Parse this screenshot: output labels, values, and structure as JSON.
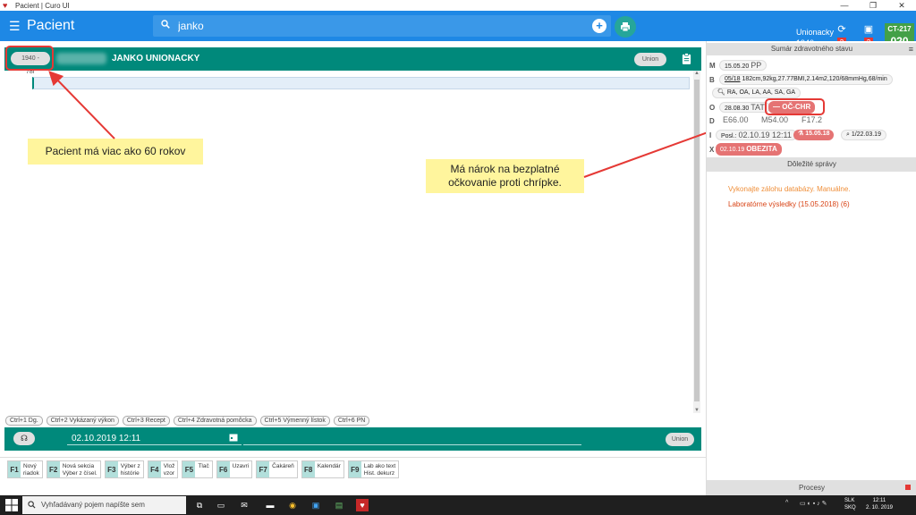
{
  "window": {
    "title": "Pacient | Curo UI"
  },
  "appbar": {
    "title": "Pacient",
    "search_value": "janko",
    "user_name": "Unionacky",
    "user_year": "1940",
    "sync_badge": "2",
    "alert_badge": "2",
    "ct_code": "CT-217",
    "ct_number": "020"
  },
  "patient": {
    "age_pill": "1940 - 78r",
    "name": "JANKO UNIONACKY",
    "insurer_pill": "Union"
  },
  "annotations": {
    "age_note": "Pacient má viac ako 60 rokov",
    "vaccination_note_line1": "Má nárok na bezplatné",
    "vaccination_note_line2": "očkovanie proti chrípke."
  },
  "shortcuts": [
    "Ctrl+1 Dg.",
    "Ctrl+2 Vykázaný výkon",
    "Ctrl+3 Recept",
    "Ctrl+4 Zdravotná pomôcka",
    "Ctrl+5 Výmenný lístok",
    "Ctrl+6 PN"
  ],
  "bottom_bar": {
    "datetime": "02.10.2019 12:11",
    "insurer_pill": "Union"
  },
  "function_keys": [
    {
      "key": "F1",
      "line1": "Nový",
      "line2": "riadok"
    },
    {
      "key": "F2",
      "line1": "Nová sekcia",
      "line2": "Výber z čísel."
    },
    {
      "key": "F3",
      "line1": "Výber z",
      "line2": "histórie"
    },
    {
      "key": "F4",
      "line1": "Vlož",
      "line2": "vzor"
    },
    {
      "key": "F5",
      "line1": "Tlač",
      "line2": ""
    },
    {
      "key": "F6",
      "line1": "Uzavri",
      "line2": ""
    },
    {
      "key": "F7",
      "line1": "Čakáreň",
      "line2": ""
    },
    {
      "key": "F8",
      "line1": "Kalendár",
      "line2": ""
    },
    {
      "key": "F9",
      "line1": "Lab ako text",
      "line2": "Hist. dekurz"
    }
  ],
  "summary": {
    "header": "Sumár zdravotného stavu",
    "m_letter": "M",
    "m_date": "15.05.20",
    "m_code": "PP",
    "b_letter": "B",
    "b_date": "05/18",
    "b_values": "182cm,92kg,27.77BMI,2.14m2,120/68mmHg,68/min",
    "b_tags": "RA, OA, LA, AA, SA, GA",
    "o_letter": "O",
    "o_date": "28.08.30",
    "o_code": "TAT",
    "o_occhr": "— OČ-CHR",
    "d_letter": "D",
    "d_code1": "E66.00",
    "d_code2": "M54.00",
    "d_code3": "F17.2",
    "i_letter": "I",
    "i_label": "Posl.:",
    "i_date": "02.10.19 12:11",
    "i_chip": "15.05.18",
    "i_attach": "1/22.03.19",
    "x_letter": "X",
    "x_date": "02.10.19",
    "x_label": "OBEZITA"
  },
  "messages": {
    "header": "Dôležité správy",
    "items": [
      "Vykonajte zálohu databázy. Manuálne.",
      "Laboratórne výsledky (15.05.2018) (6)"
    ]
  },
  "processes": {
    "label": "Procesy"
  },
  "taskbar": {
    "search_placeholder": "Vyhľadávaný pojem napíšte sem",
    "lang1": "SLK",
    "lang2": "SKQ",
    "time": "12:11",
    "date": "2. 10. 2019"
  },
  "colors": {
    "appbar": "#1e88e5",
    "teal": "#00897b",
    "alert": "#e53935",
    "tooltip": "#fff59d"
  }
}
